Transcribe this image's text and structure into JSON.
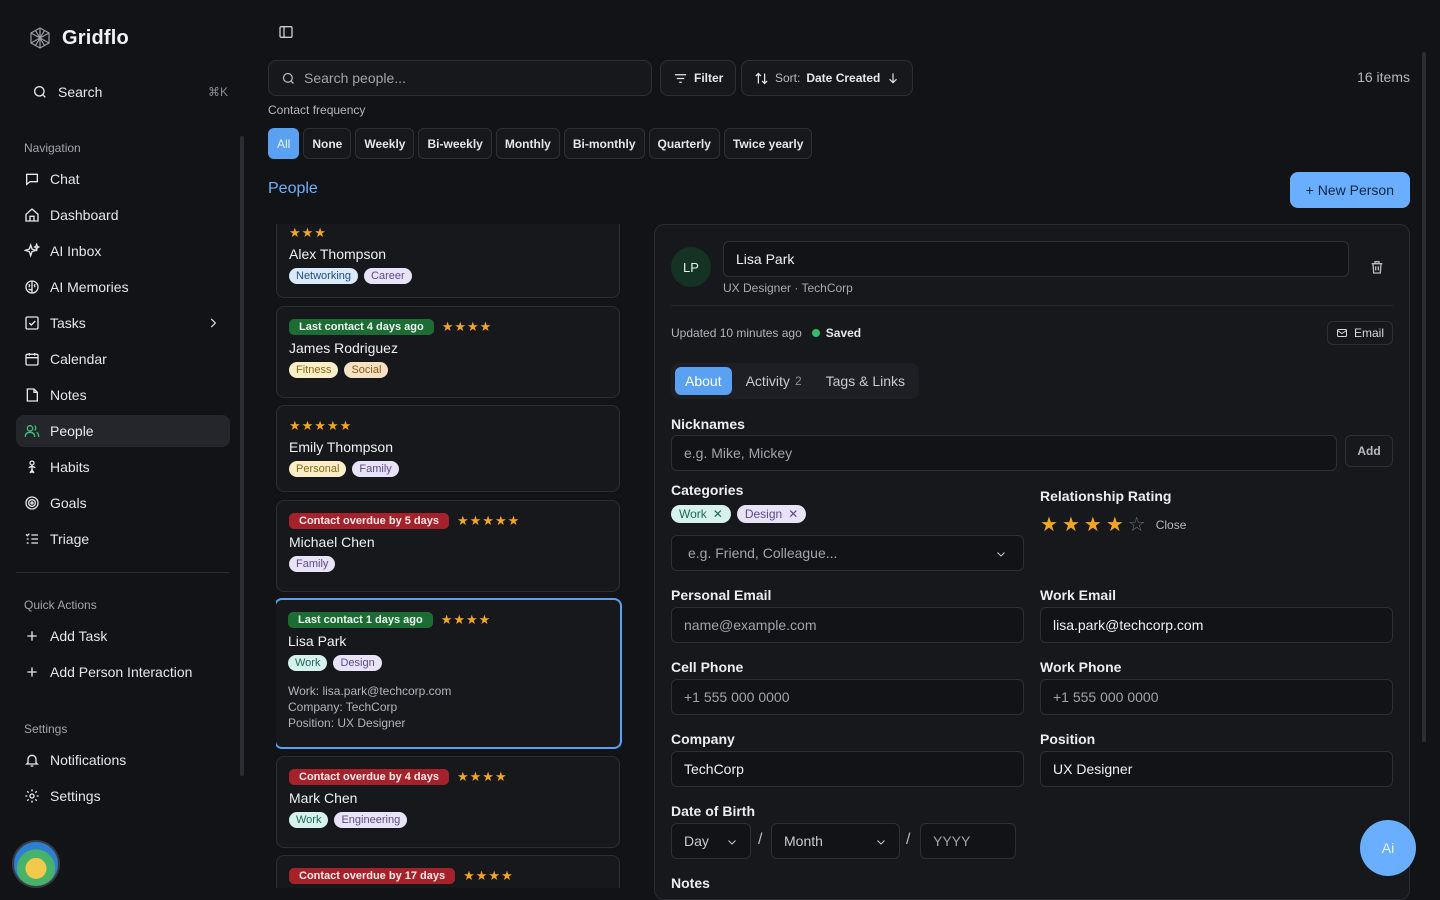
{
  "app": {
    "name": "Gridflo"
  },
  "sidebar": {
    "search_label": "Search",
    "search_shortcut": "⌘K",
    "nav_title": "Navigation",
    "items": [
      {
        "label": "Chat",
        "icon": "chat-icon"
      },
      {
        "label": "Dashboard",
        "icon": "home-icon"
      },
      {
        "label": "AI Inbox",
        "icon": "sparkles-icon"
      },
      {
        "label": "AI Memories",
        "icon": "brain-icon"
      },
      {
        "label": "Tasks",
        "icon": "checkbox-icon"
      },
      {
        "label": "Calendar",
        "icon": "calendar-icon"
      },
      {
        "label": "Notes",
        "icon": "note-icon"
      },
      {
        "label": "People",
        "icon": "users-icon"
      },
      {
        "label": "Habits",
        "icon": "habit-icon"
      },
      {
        "label": "Goals",
        "icon": "target-icon"
      },
      {
        "label": "Triage",
        "icon": "list-icon"
      }
    ],
    "quick_title": "Quick Actions",
    "quick_actions": [
      {
        "label": "Add Task"
      },
      {
        "label": "Add Person Interaction"
      }
    ],
    "settings_title": "Settings",
    "settings_items": [
      {
        "label": "Notifications"
      },
      {
        "label": "Settings"
      }
    ]
  },
  "toolbar": {
    "search_placeholder": "Search people...",
    "filter_label": "Filter",
    "sort_prefix": "Sort:",
    "sort_value": "Date Created",
    "items_count": "16 items"
  },
  "frequency": {
    "label": "Contact frequency",
    "options": [
      "All",
      "None",
      "Weekly",
      "Bi-weekly",
      "Monthly",
      "Bi-monthly",
      "Quarterly",
      "Twice yearly"
    ],
    "selected": "All"
  },
  "people": {
    "title": "People",
    "new_button": "+ New Person",
    "cards": [
      {
        "badge": "",
        "stars": 3,
        "name": "Alex Thompson",
        "tags": [
          "Networking",
          "Career"
        ]
      },
      {
        "badge": "Last contact 4 days ago",
        "status": "ok",
        "stars": 4,
        "name": "James Rodriguez",
        "tags": [
          "Fitness",
          "Social"
        ]
      },
      {
        "badge": "",
        "stars": 5,
        "name": "Emily Thompson",
        "tags": [
          "Personal",
          "Family"
        ]
      },
      {
        "badge": "Contact overdue by 5 days",
        "status": "overdue",
        "stars": 5,
        "name": "Michael Chen",
        "tags": [
          "Family"
        ]
      },
      {
        "badge": "Last contact 1 days ago",
        "status": "ok",
        "stars": 4,
        "name": "Lisa Park",
        "tags": [
          "Work",
          "Design"
        ],
        "meta": [
          "Work: lisa.park@techcorp.com",
          "Company: TechCorp",
          "Position: UX Designer"
        ]
      },
      {
        "badge": "Contact overdue by 4 days",
        "status": "overdue",
        "stars": 4,
        "name": "Mark Chen",
        "tags": [
          "Work",
          "Engineering"
        ]
      },
      {
        "badge": "Contact overdue by 17 days",
        "status": "overdue",
        "stars": 4,
        "name": "",
        "tags": []
      }
    ]
  },
  "detail": {
    "initials": "LP",
    "name": "Lisa Park",
    "subtitle": "UX Designer · TechCorp",
    "updated": "Updated 10 minutes ago",
    "saved": "Saved",
    "email_button": "Email",
    "tabs": [
      {
        "label": "About",
        "count": ""
      },
      {
        "label": "Activity",
        "count": "2"
      },
      {
        "label": "Tags & Links",
        "count": ""
      }
    ],
    "nicknames_label": "Nicknames",
    "nicknames_placeholder": "e.g. Mike, Mickey",
    "add_label": "Add",
    "categories_label": "Categories",
    "categories": [
      "Work",
      "Design"
    ],
    "categories_placeholder": "e.g. Friend, Colleague...",
    "rating_label": "Relationship Rating",
    "rating_value": 4,
    "rating_max": 5,
    "rating_text": "Close",
    "personal_email_label": "Personal Email",
    "personal_email_placeholder": "name@example.com",
    "work_email_label": "Work Email",
    "work_email_value": "lisa.park@techcorp.com",
    "cell_phone_label": "Cell Phone",
    "cell_phone_placeholder": "+1 555 000 0000",
    "work_phone_label": "Work Phone",
    "work_phone_placeholder": "+1 555 000 0000",
    "company_label": "Company",
    "company_value": "TechCorp",
    "position_label": "Position",
    "position_value": "UX Designer",
    "dob_label": "Date of Birth",
    "dob_day": "Day",
    "dob_month": "Month",
    "dob_year_placeholder": "YYYY",
    "notes_label": "Notes"
  },
  "ai_button": "Ai",
  "colors": {
    "accent": "#5aa1f2",
    "ok": "#1d6b35",
    "overdue": "#a5222b",
    "star": "#f5a524"
  }
}
